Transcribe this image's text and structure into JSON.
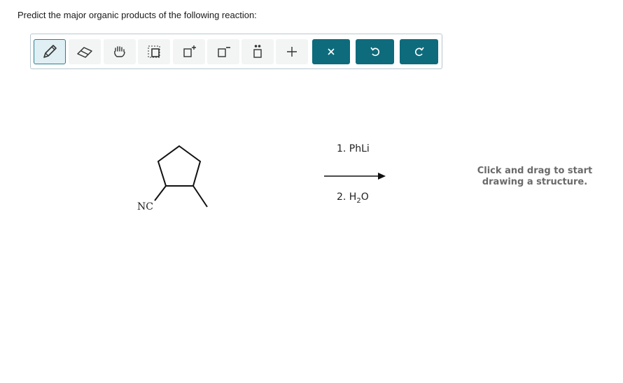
{
  "question": {
    "text": "Predict the major organic products of the following reaction:"
  },
  "toolbar": {
    "buttons": [
      {
        "name": "draw-tool",
        "icon": "pencil-icon",
        "active": true
      },
      {
        "name": "erase-tool",
        "icon": "eraser-icon"
      },
      {
        "name": "move-tool",
        "icon": "hand-icon"
      },
      {
        "name": "select-tool",
        "icon": "lasso-select-icon"
      },
      {
        "name": "positive-charge-tool",
        "icon": "plus-charge-icon"
      },
      {
        "name": "negative-charge-tool",
        "icon": "minus-charge-icon"
      },
      {
        "name": "lone-pair-tool",
        "icon": "lone-pair-icon"
      },
      {
        "name": "add-tool",
        "icon": "plus-icon"
      },
      {
        "name": "clear-button",
        "icon": "close-icon"
      },
      {
        "name": "undo-button",
        "icon": "undo-icon"
      },
      {
        "name": "redo-button",
        "icon": "redo-icon"
      }
    ],
    "accent_color": "#0e6b7c"
  },
  "reaction": {
    "substituent_label": "NC",
    "step1": "1. PhLi",
    "step2_prefix": "2. H",
    "step2_sub": "2",
    "step2_suffix": "O"
  },
  "canvas": {
    "hint_line1": "Click and drag to start",
    "hint_line2": "drawing a structure."
  }
}
